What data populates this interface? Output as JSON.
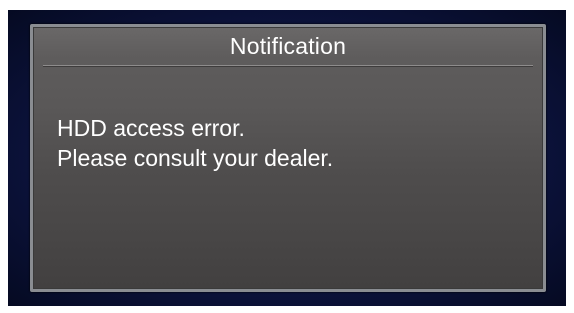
{
  "notification": {
    "title": "Notification",
    "message_lines": [
      "HDD access error.",
      "Please consult your dealer."
    ]
  },
  "colors": {
    "background_outer": "#0d1440",
    "dialog_fill": "#555353",
    "dialog_border": "#8a8d92",
    "text": "#ffffff"
  }
}
